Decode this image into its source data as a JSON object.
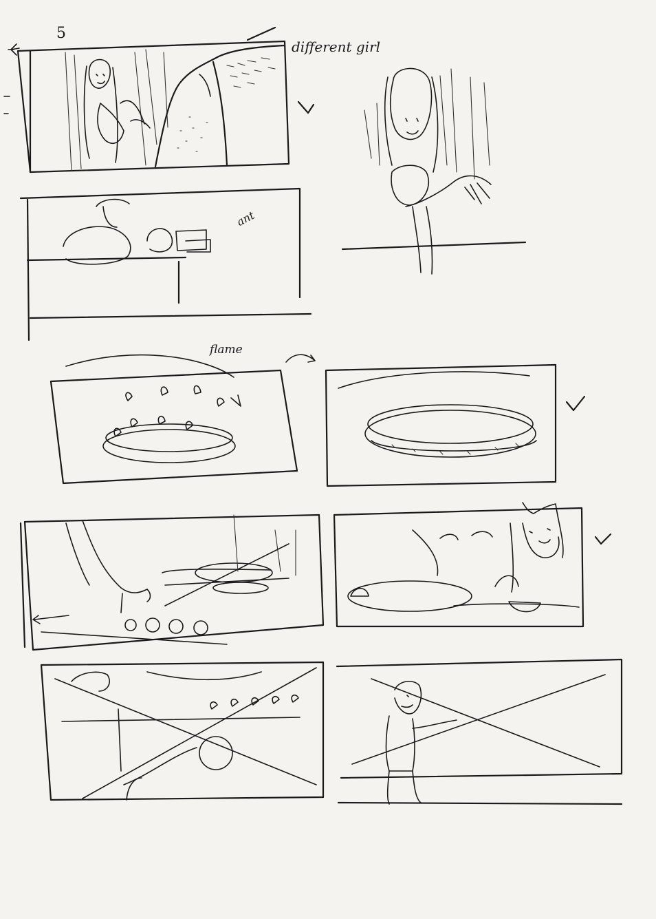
{
  "page": {
    "number": "5",
    "notes": {
      "different_girl": "different girl",
      "flame": "flame",
      "ant": "ant"
    }
  },
  "panels": [
    {
      "id": "p1",
      "subject": "girl in shower"
    },
    {
      "id": "p2",
      "subject": "different girl in shower"
    },
    {
      "id": "p3",
      "subject": "bedroom with pillows"
    },
    {
      "id": "p4",
      "subject": "gas flame"
    },
    {
      "id": "p5",
      "subject": "pan on burner"
    },
    {
      "id": "p6",
      "subject": "hand on stove knob"
    },
    {
      "id": "p7",
      "subject": "cat at stove"
    },
    {
      "id": "p8",
      "subject": "flame and hand"
    },
    {
      "id": "p9",
      "subject": "person standing"
    }
  ],
  "marks": {
    "checkmark": "check-icon",
    "cross": "cross-icon"
  }
}
